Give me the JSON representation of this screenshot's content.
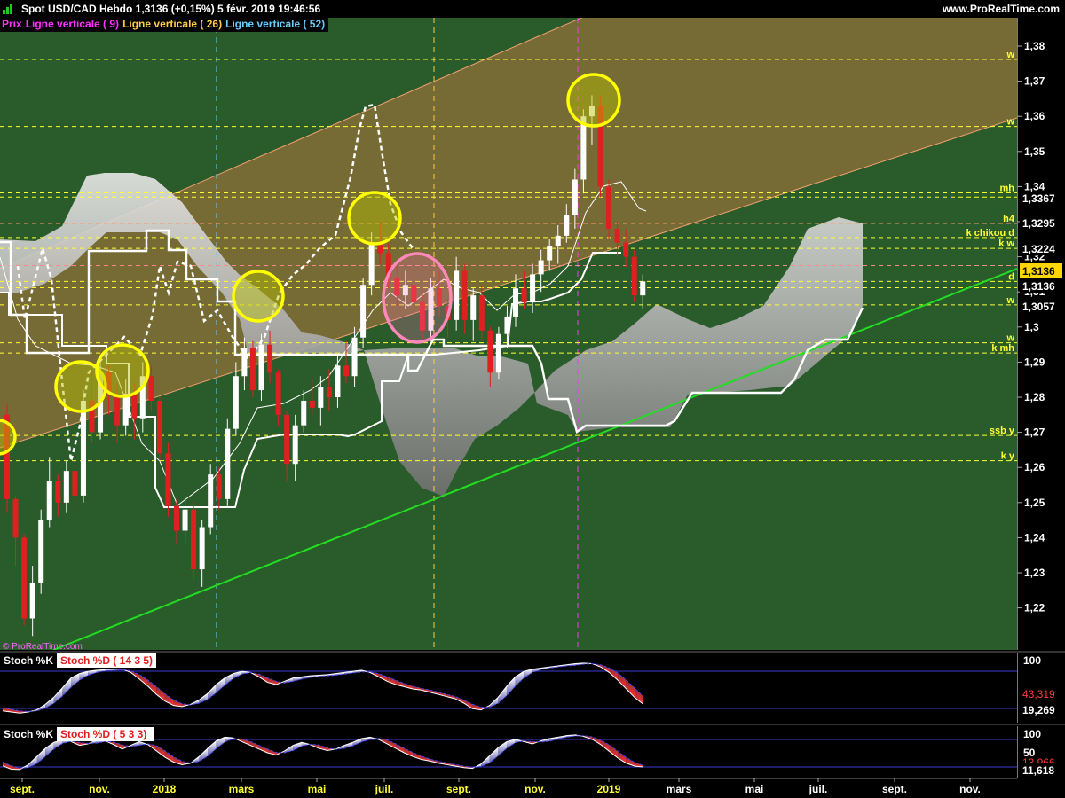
{
  "header": {
    "symbol_line": "Spot USD/CAD   Hebdo   1,3136 (+0,15%)   5 févr. 2019 19:46:56",
    "site": "www.ProRealTime.com"
  },
  "legend": [
    {
      "label": "Prix",
      "color": "#ff33ff"
    },
    {
      "label": "Ligne verticale ( 9)",
      "color": "#ff33ff"
    },
    {
      "label": "Ligne verticale ( 26)",
      "color": "#ffcc44"
    },
    {
      "label": "Ligne verticale ( 52)",
      "color": "#66ccff"
    }
  ],
  "watermark": "© ProRealTime.com",
  "colors": {
    "price_bg": "#2a5b2a",
    "up": "#ffffff",
    "down": "#e02020",
    "trend": "#22dd22",
    "channel": "#e8905a",
    "level": "#ffff33"
  },
  "chart_data": [
    {
      "type": "candlestick",
      "title": "Spot USD/CAD",
      "timeframe": "Hebdo",
      "last": "1,3136",
      "change": "(+0,15%)",
      "y_ticks": [
        "1,38",
        "1,37",
        "1,36",
        "1,35",
        "1,34",
        "1,33",
        "1,32",
        "1,31",
        "1,3",
        "1,29",
        "1,28",
        "1,27",
        "1,26",
        "1,25",
        "1,24",
        "1,23",
        "1,22"
      ],
      "ylim": [
        1.2125,
        1.3862
      ],
      "x_labels": [
        "sept.",
        "nov.",
        "2018",
        "mars",
        "mai",
        "juil.",
        "sept.",
        "nov.",
        "2019",
        "mars",
        "mai",
        "juil.",
        "sept.",
        "nov."
      ],
      "price_labels": [
        {
          "text": "1,3367",
          "value": 1.3367
        },
        {
          "text": "1,3295",
          "value": 1.3295
        },
        {
          "text": "1,3224",
          "value": 1.3224
        },
        {
          "text": "1,3136",
          "value": 1.3136,
          "current": true
        },
        {
          "text": "1,3136",
          "value": 1.3136
        },
        {
          "text": "1,3057",
          "value": 1.3057
        }
      ],
      "levels": [
        {
          "value": 1.3762,
          "text": "w",
          "color": "#ffff33"
        },
        {
          "value": 1.3571,
          "text": "w",
          "color": "#ffff33"
        },
        {
          "value": 1.3382,
          "text": "mh",
          "color": "#ffff33"
        },
        {
          "value": 1.337,
          "text": "",
          "color": "#ffff33"
        },
        {
          "value": 1.3295,
          "text": "h4",
          "color": "#ff9966"
        },
        {
          "value": 1.3255,
          "text": "k chikou d",
          "color": "#ffff33"
        },
        {
          "value": 1.3224,
          "text": "k w",
          "color": "#ffff33"
        },
        {
          "value": 1.3175,
          "text": "",
          "color": "#ff8888"
        },
        {
          "value": 1.313,
          "text": "d",
          "color": "#ffff33"
        },
        {
          "value": 1.3112,
          "text": "",
          "color": "#ffff33"
        },
        {
          "value": 1.3063,
          "text": "w",
          "color": "#ffff33"
        },
        {
          "value": 1.2955,
          "text": "w",
          "color": "#ffff33"
        },
        {
          "value": 1.2926,
          "text": "k mh",
          "color": "#ffff33"
        },
        {
          "value": 1.2691,
          "text": "ssb y",
          "color": "#ffff33"
        },
        {
          "value": 1.2619,
          "text": "k y",
          "color": "#ffff33"
        }
      ],
      "candles_ohlc": [
        [
          1.275,
          1.278,
          1.247,
          1.251
        ],
        [
          1.251,
          1.252,
          1.232,
          1.24
        ],
        [
          1.24,
          1.241,
          1.215,
          1.217
        ],
        [
          1.217,
          1.232,
          1.212,
          1.227
        ],
        [
          1.227,
          1.248,
          1.224,
          1.245
        ],
        [
          1.245,
          1.263,
          1.243,
          1.256
        ],
        [
          1.256,
          1.258,
          1.246,
          1.25
        ],
        [
          1.25,
          1.262,
          1.247,
          1.259
        ],
        [
          1.259,
          1.261,
          1.247,
          1.252
        ],
        [
          1.252,
          1.282,
          1.25,
          1.279
        ],
        [
          1.279,
          1.288,
          1.267,
          1.27
        ],
        [
          1.27,
          1.291,
          1.268,
          1.287
        ],
        [
          1.287,
          1.289,
          1.275,
          1.281
        ],
        [
          1.281,
          1.284,
          1.267,
          1.272
        ],
        [
          1.272,
          1.285,
          1.269,
          1.281
        ],
        [
          1.281,
          1.284,
          1.268,
          1.274
        ],
        [
          1.274,
          1.29,
          1.27,
          1.286
        ],
        [
          1.286,
          1.289,
          1.276,
          1.279
        ],
        [
          1.279,
          1.28,
          1.262,
          1.264
        ],
        [
          1.264,
          1.267,
          1.246,
          1.249
        ],
        [
          1.249,
          1.251,
          1.238,
          1.242
        ],
        [
          1.242,
          1.252,
          1.238,
          1.248
        ],
        [
          1.248,
          1.25,
          1.228,
          1.231
        ],
        [
          1.231,
          1.245,
          1.226,
          1.243
        ],
        [
          1.243,
          1.261,
          1.241,
          1.258
        ],
        [
          1.258,
          1.26,
          1.248,
          1.251
        ],
        [
          1.251,
          1.274,
          1.249,
          1.271
        ],
        [
          1.271,
          1.29,
          1.269,
          1.286
        ],
        [
          1.286,
          1.297,
          1.282,
          1.294
        ],
        [
          1.294,
          1.296,
          1.28,
          1.282
        ],
        [
          1.282,
          1.298,
          1.279,
          1.295
        ],
        [
          1.295,
          1.299,
          1.284,
          1.287
        ],
        [
          1.287,
          1.288,
          1.272,
          1.275
        ],
        [
          1.275,
          1.276,
          1.256,
          1.261
        ],
        [
          1.261,
          1.275,
          1.256,
          1.272
        ],
        [
          1.272,
          1.282,
          1.27,
          1.279
        ],
        [
          1.279,
          1.285,
          1.275,
          1.277
        ],
        [
          1.277,
          1.286,
          1.272,
          1.283
        ],
        [
          1.283,
          1.288,
          1.276,
          1.28
        ],
        [
          1.28,
          1.292,
          1.277,
          1.289
        ],
        [
          1.289,
          1.296,
          1.284,
          1.286
        ],
        [
          1.286,
          1.3,
          1.283,
          1.297
        ],
        [
          1.297,
          1.314,
          1.294,
          1.312
        ],
        [
          1.312,
          1.327,
          1.309,
          1.324
        ],
        [
          1.324,
          1.33,
          1.318,
          1.321
        ],
        [
          1.321,
          1.324,
          1.311,
          1.314
        ],
        [
          1.314,
          1.318,
          1.306,
          1.309
        ],
        [
          1.309,
          1.316,
          1.305,
          1.312
        ],
        [
          1.312,
          1.315,
          1.304,
          1.307
        ],
        [
          1.307,
          1.31,
          1.296,
          1.299
        ],
        [
          1.299,
          1.314,
          1.296,
          1.311
        ],
        [
          1.311,
          1.316,
          1.303,
          1.306
        ],
        [
          1.306,
          1.308,
          1.297,
          1.302
        ],
        [
          1.302,
          1.32,
          1.299,
          1.316
        ],
        [
          1.316,
          1.318,
          1.298,
          1.302
        ],
        [
          1.302,
          1.311,
          1.296,
          1.309
        ],
        [
          1.309,
          1.312,
          1.296,
          1.299
        ],
        [
          1.299,
          1.3,
          1.283,
          1.287
        ],
        [
          1.287,
          1.3,
          1.285,
          1.298
        ],
        [
          1.298,
          1.306,
          1.294,
          1.303
        ],
        [
          1.303,
          1.315,
          1.3,
          1.311
        ],
        [
          1.311,
          1.316,
          1.305,
          1.307
        ],
        [
          1.307,
          1.318,
          1.304,
          1.315
        ],
        [
          1.315,
          1.322,
          1.31,
          1.319
        ],
        [
          1.319,
          1.325,
          1.316,
          1.323
        ],
        [
          1.323,
          1.329,
          1.318,
          1.326
        ],
        [
          1.326,
          1.335,
          1.324,
          1.332
        ],
        [
          1.332,
          1.345,
          1.328,
          1.342
        ],
        [
          1.342,
          1.362,
          1.338,
          1.36
        ],
        [
          1.36,
          1.366,
          1.352,
          1.363
        ],
        [
          1.363,
          1.366,
          1.337,
          1.34
        ],
        [
          1.34,
          1.342,
          1.325,
          1.328
        ],
        [
          1.328,
          1.33,
          1.32,
          1.324
        ],
        [
          1.324,
          1.328,
          1.317,
          1.32
        ],
        [
          1.32,
          1.322,
          1.307,
          1.309
        ],
        [
          1.309,
          1.315,
          1.305,
          1.313
        ]
      ]
    },
    {
      "type": "line",
      "title": "Stoch %K",
      "series": [
        {
          "name": "Stoch %K"
        },
        {
          "name": "Stoch %D ( 14 3 5)"
        }
      ],
      "y_ticks": [
        "100"
      ],
      "current_values": [
        "43,319",
        "19,269"
      ],
      "k": [
        10,
        8,
        6,
        8,
        12,
        22,
        35,
        52,
        70,
        78,
        82,
        84,
        85,
        86,
        86,
        80,
        68,
        55,
        40,
        28,
        20,
        18,
        22,
        30,
        42,
        58,
        70,
        78,
        82,
        80,
        72,
        62,
        58,
        64,
        70,
        72,
        74,
        75,
        76,
        78,
        80,
        82,
        84,
        80,
        72,
        64,
        58,
        54,
        50,
        48,
        44,
        40,
        36,
        32,
        24,
        14,
        12,
        20,
        35,
        55,
        72,
        82,
        86,
        88,
        90,
        92,
        94,
        96,
        97,
        96,
        90,
        80,
        66,
        50,
        34,
        22
      ],
      "d": [
        16,
        13,
        10,
        9,
        10,
        15,
        24,
        37,
        53,
        66,
        75,
        80,
        83,
        84,
        85,
        83,
        76,
        66,
        54,
        41,
        30,
        23,
        21,
        24,
        31,
        43,
        57,
        69,
        77,
        80,
        77,
        70,
        64,
        61,
        64,
        68,
        71,
        73,
        74,
        75,
        77,
        79,
        81,
        81,
        78,
        72,
        66,
        60,
        55,
        51,
        48,
        44,
        40,
        36,
        30,
        22,
        17,
        17,
        24,
        38,
        55,
        70,
        80,
        85,
        88,
        90,
        92,
        93,
        95,
        96,
        94,
        88,
        79,
        66,
        51,
        36
      ]
    },
    {
      "type": "line",
      "title": "Stoch %K",
      "series": [
        {
          "name": "Stoch %K"
        },
        {
          "name": "Stoch %D ( 5 3 3)"
        }
      ],
      "y_ticks": [
        "100",
        "50"
      ],
      "current_values": [
        "13,966",
        "11,618"
      ],
      "k": [
        15,
        6,
        5,
        18,
        40,
        62,
        78,
        85,
        80,
        70,
        74,
        84,
        82,
        72,
        60,
        70,
        80,
        72,
        55,
        38,
        25,
        18,
        22,
        40,
        62,
        82,
        92,
        90,
        80,
        70,
        60,
        50,
        44,
        55,
        70,
        78,
        72,
        62,
        56,
        60,
        70,
        78,
        88,
        92,
        86,
        74,
        62,
        50,
        40,
        32,
        28,
        22,
        18,
        14,
        10,
        8,
        20,
        42,
        64,
        80,
        86,
        80,
        74,
        82,
        88,
        92,
        96,
        98,
        94,
        86,
        72,
        54,
        36,
        22,
        14,
        12
      ],
      "d": [
        25,
        15,
        9,
        10,
        21,
        40,
        60,
        75,
        81,
        78,
        75,
        76,
        80,
        79,
        71,
        67,
        70,
        74,
        69,
        55,
        39,
        27,
        22,
        27,
        41,
        61,
        79,
        88,
        87,
        80,
        70,
        60,
        51,
        50,
        56,
        68,
        73,
        71,
        63,
        59,
        62,
        69,
        79,
        86,
        89,
        84,
        74,
        62,
        51,
        41,
        33,
        27,
        23,
        18,
        14,
        11,
        13,
        23,
        42,
        62,
        77,
        82,
        80,
        79,
        81,
        87,
        92,
        95,
        96,
        93,
        84,
        71,
        54,
        37,
        24,
        16
      ]
    }
  ]
}
